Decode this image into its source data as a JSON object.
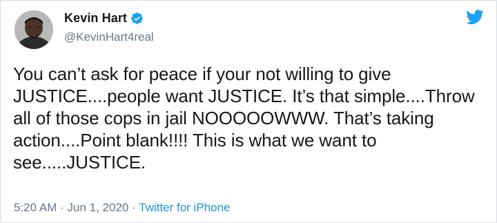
{
  "author": {
    "display_name": "Kevin Hart",
    "handle": "@KevinHart4real",
    "verified": true,
    "avatar_icon": "profile-photo"
  },
  "tweet": {
    "text": "You can’t ask for peace if your not willing to give\nJUSTICE....people want JUSTICE. It’s that simple....Throw\nall of those cops in jail NOOOOOWWW. That’s taking\naction....Point blank!!!! This is what we want to\nsee.....JUSTICE.",
    "time": "5:20 AM",
    "separator": "·",
    "date": "Jun 1, 2020",
    "source": "Twitter for iPhone"
  },
  "icons": {
    "verified": "verified-badge-icon",
    "brand": "twitter-bird-icon"
  },
  "colors": {
    "brand": "#1da1f2",
    "text": "#14171a",
    "secondary": "#657786",
    "link": "#1b95e0"
  }
}
